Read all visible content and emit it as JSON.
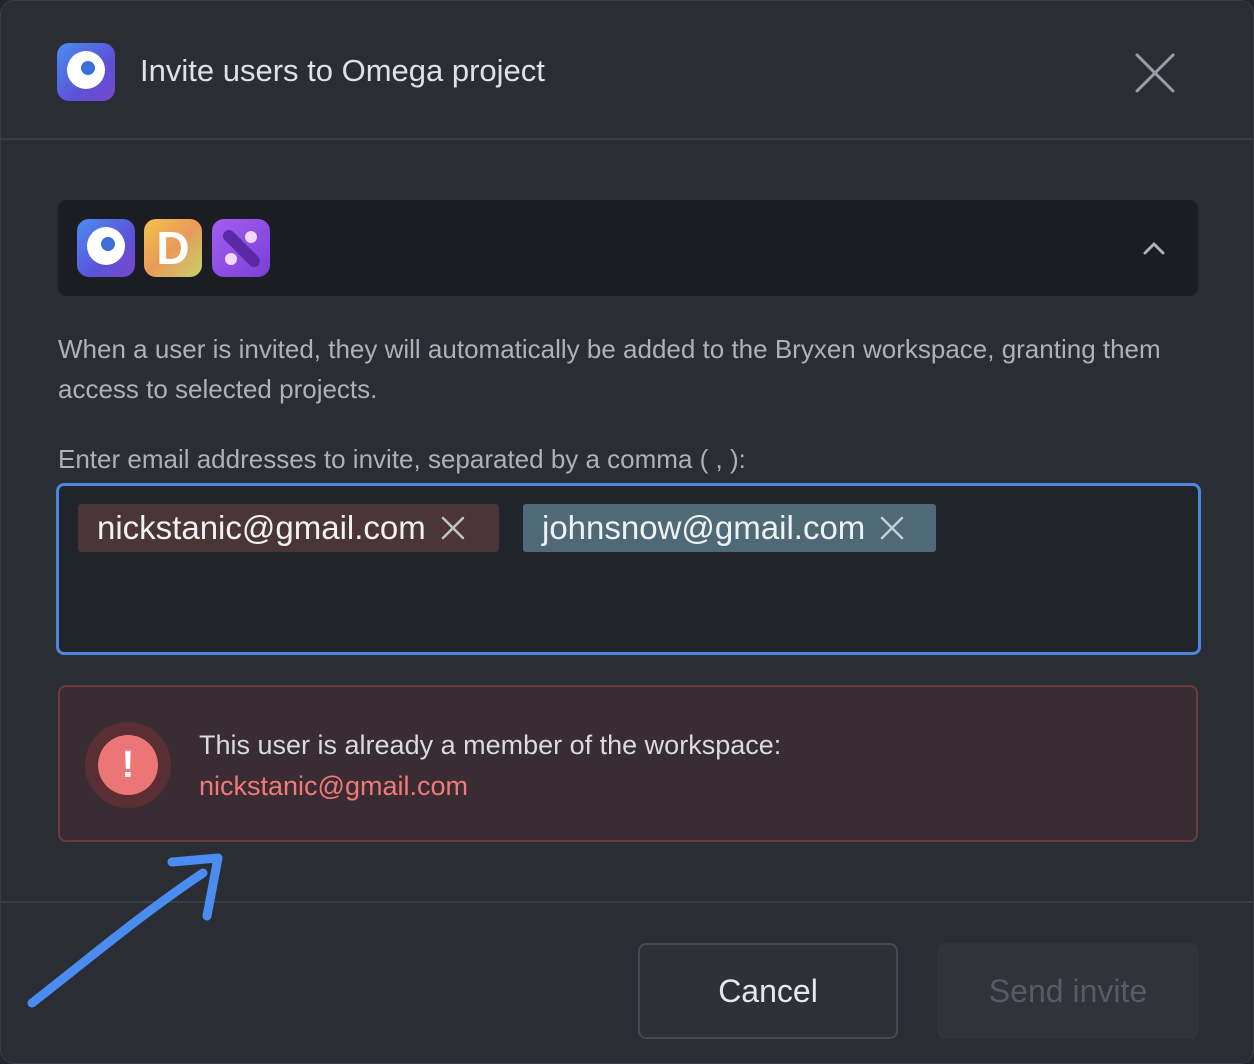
{
  "dialog": {
    "title": "Invite users to Omega project",
    "close_icon": "close-icon"
  },
  "apps": {
    "items": [
      {
        "name": "omega",
        "icon": "omega-app-icon"
      },
      {
        "name": "d-app",
        "letter": "D",
        "icon": "d-app-icon"
      },
      {
        "name": "x-app",
        "icon": "x-app-icon"
      }
    ],
    "toggle_icon": "chevron-up-icon"
  },
  "description": "When a user is invited, they will automatically be added to the Bryxen workspace, granting them access to selected projects.",
  "email_input": {
    "label": "Enter email addresses to invite, separated by a comma ( , ):",
    "tags": [
      {
        "email": "nickstanic@gmail.com",
        "status": "error"
      },
      {
        "email": "johnsnow@gmail.com",
        "status": "ok"
      }
    ]
  },
  "alert": {
    "message": "This user is already a member of the workspace:",
    "email": "nickstanic@gmail.com",
    "icon_symbol": "!"
  },
  "footer": {
    "cancel_label": "Cancel",
    "send_label": "Send invite"
  },
  "colors": {
    "accent": "#4d86de",
    "error": "#ef7a79",
    "annotation": "#4a8cf0"
  }
}
